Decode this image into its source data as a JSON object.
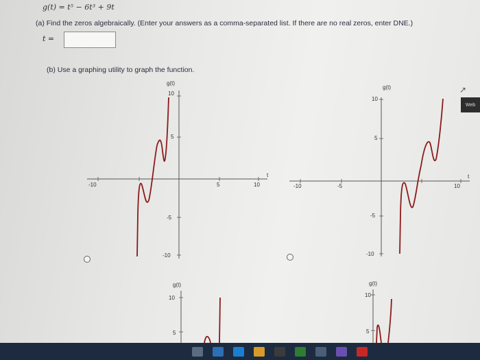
{
  "function_text": "g(t) = t⁵ − 6t³ + 9t",
  "question_a": "(a) Find the zeros algebraically. (Enter your answers as a comma-separated list. If there are no real zeros, enter DNE.)",
  "t_label": "t =",
  "answer_value": "",
  "question_b": "(b) Use a graphing utility to graph the function.",
  "web_tab": "Web",
  "graphs": [
    {
      "ylabel": "g(t)",
      "xlabel": "t",
      "ticks_x": [
        "-10",
        "5",
        "10"
      ],
      "ticks_y": [
        "10",
        "5",
        "-5",
        "-10"
      ]
    },
    {
      "ylabel": "g(t)",
      "xlabel": "t",
      "ticks_x": [
        "-10",
        "-5",
        "10"
      ],
      "ticks_y": [
        "10",
        "5",
        "-5",
        "-10"
      ]
    },
    {
      "ylabel": "g(t)",
      "ticks_y": [
        "10",
        "5"
      ]
    },
    {
      "ylabel": "g(t)",
      "ticks_y": [
        "10",
        "5"
      ]
    }
  ],
  "colors": {
    "curve": "#8b1a1a",
    "taskbar": "#1d2b40"
  }
}
